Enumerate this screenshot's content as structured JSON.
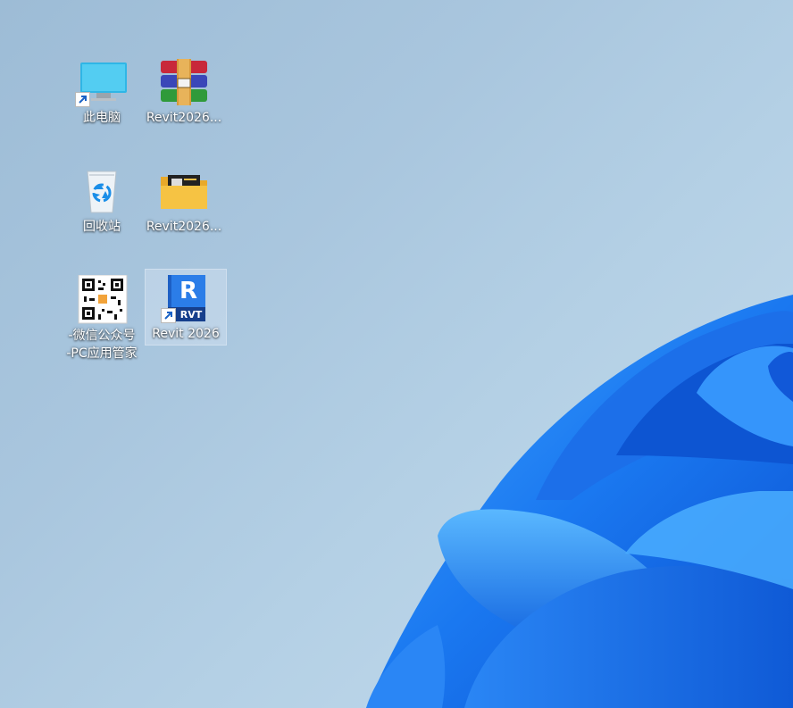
{
  "desktop": {
    "icons": [
      {
        "label": "此电脑",
        "icon": "this-pc-icon"
      },
      {
        "label": "Revit2026...",
        "icon": "winrar-archive-icon"
      },
      {
        "label": "回收站",
        "icon": "recycle-bin-icon"
      },
      {
        "label": "Revit2026...",
        "icon": "folder-icon"
      },
      {
        "label_line1": "-微信公众号",
        "label_line2": "-PC应用管家",
        "icon": "qr-code-icon"
      },
      {
        "label": "Revit 2026",
        "icon": "revit-app-icon",
        "badge": "RVT",
        "letter": "R",
        "selected": true
      }
    ]
  },
  "colors": {
    "wallpaper_blue": "#1f7cf0",
    "revit_blue": "#1d5fc4",
    "folder_yellow": "#f6c343"
  }
}
